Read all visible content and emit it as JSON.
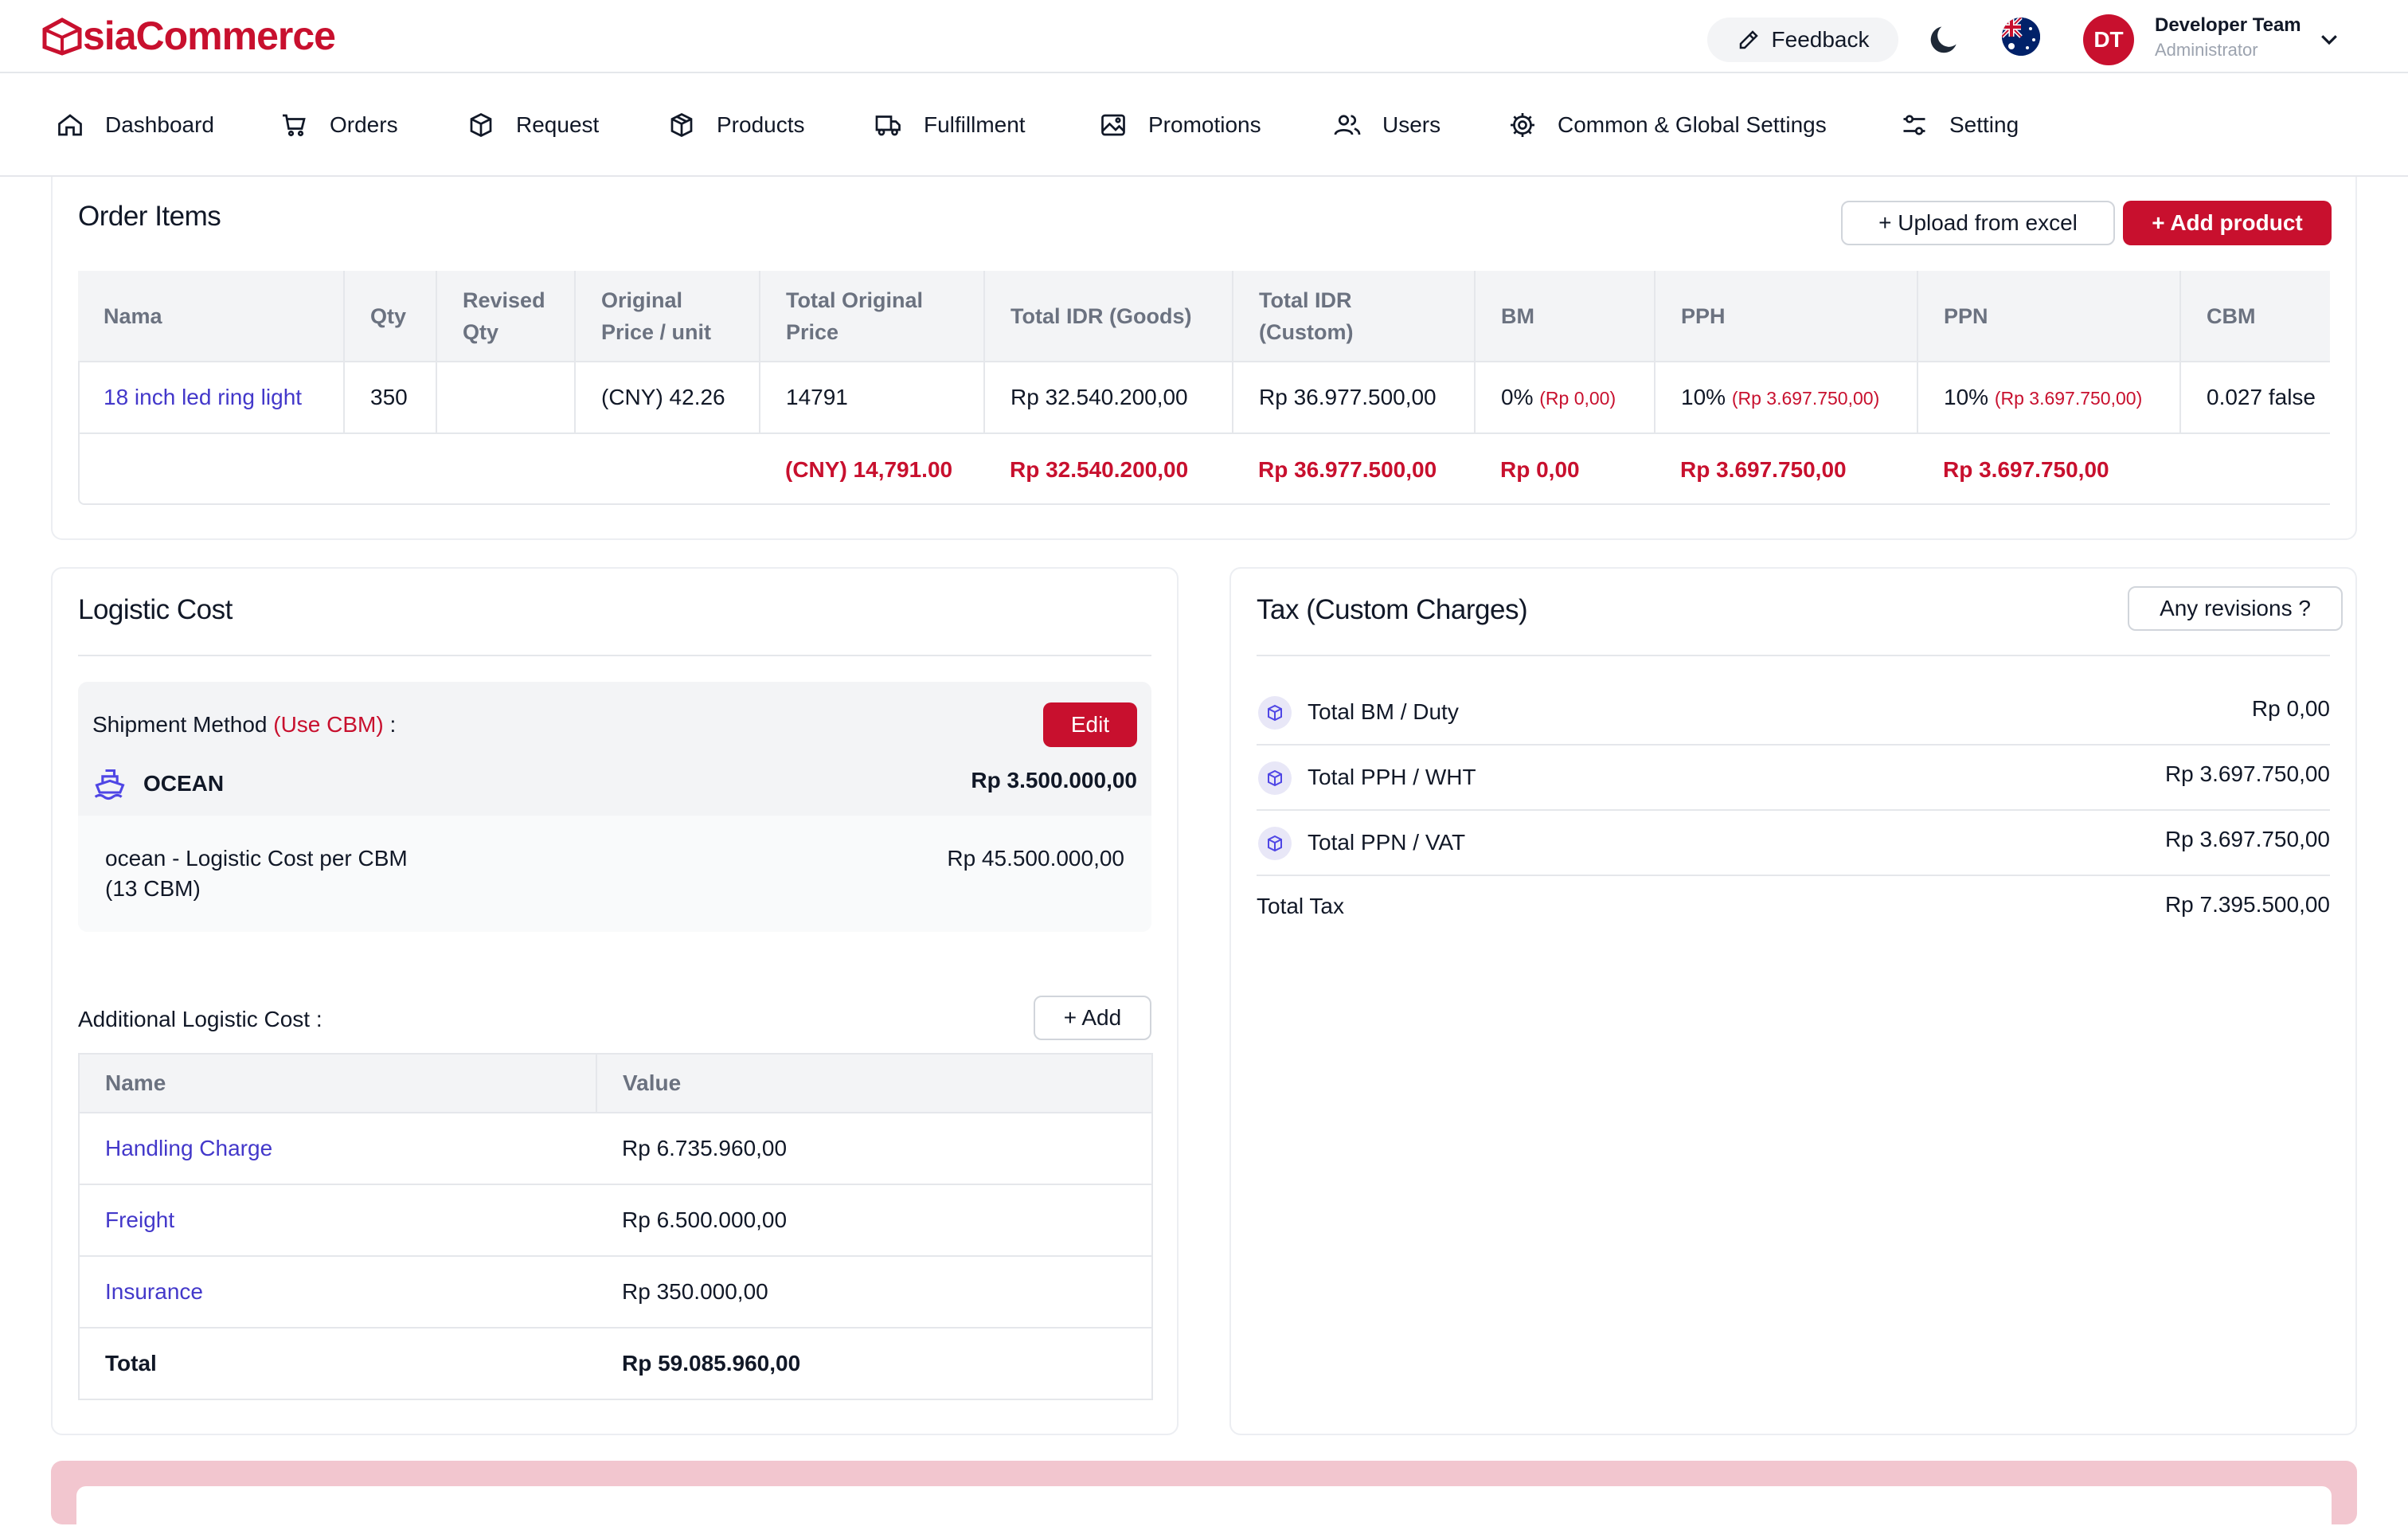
{
  "header": {
    "logo_text": "siaCommerce",
    "feedback_label": "Feedback",
    "user_initials": "DT",
    "user_name": "Developer Team",
    "user_role": "Administrator"
  },
  "nav": [
    {
      "label": "Dashboard",
      "icon": "home-icon"
    },
    {
      "label": "Orders",
      "icon": "cart-icon"
    },
    {
      "label": "Request",
      "icon": "box-icon"
    },
    {
      "label": "Products",
      "icon": "package-icon"
    },
    {
      "label": "Fulfillment",
      "icon": "truck-icon"
    },
    {
      "label": "Promotions",
      "icon": "image-icon"
    },
    {
      "label": "Users",
      "icon": "users-icon"
    },
    {
      "label": "Common & Global Settings",
      "icon": "gear-icon"
    },
    {
      "label": "Setting",
      "icon": "sliders-icon"
    }
  ],
  "order_items": {
    "title": "Order Items",
    "upload_label": "+ Upload from excel",
    "add_product_label": "+ Add product",
    "columns": [
      "Nama",
      "Qty",
      "Revised Qty",
      "Original Price / unit",
      "Total Original Price",
      "Total IDR (Goods)",
      "Total IDR (Custom)",
      "BM",
      "PPH",
      "PPN",
      "CBM"
    ],
    "rows": [
      {
        "name": "18 inch led ring light",
        "qty": "350",
        "revised_qty": "",
        "original_price": "(CNY) 42.26",
        "total_original": "14791",
        "total_idr_goods": "Rp 32.540.200,00",
        "total_idr_custom": "Rp 36.977.500,00",
        "bm": "0%",
        "bm_amount": "(Rp 0,00)",
        "pph": "10%",
        "pph_amount": "(Rp 3.697.750,00)",
        "ppn": "10%",
        "ppn_amount": "(Rp 3.697.750,00)",
        "cbm": "0.027 false"
      }
    ],
    "totals": {
      "total_original": "(CNY) 14,791.00",
      "total_idr_goods": "Rp 32.540.200,00",
      "total_idr_custom": "Rp 36.977.500,00",
      "bm": "Rp 0,00",
      "pph": "Rp 3.697.750,00",
      "ppn": "Rp 3.697.750,00"
    }
  },
  "logistic": {
    "title": "Logistic Cost",
    "shipment_label": "Shipment Method",
    "shipment_note": "(Use CBM)",
    "shipment_colon": ":",
    "edit_label": "Edit",
    "method": "OCEAN",
    "method_cost": "Rp 3.500.000,00",
    "detail_line1": "ocean - Logistic Cost per CBM",
    "detail_line2": "(13 CBM)",
    "detail_value": "Rp 45.500.000,00",
    "additional_label": "Additional Logistic Cost :",
    "add_label": "+ Add",
    "columns": [
      "Name",
      "Value"
    ],
    "rows": [
      {
        "name": "Handling Charge",
        "value": "Rp 6.735.960,00"
      },
      {
        "name": "Freight",
        "value": "Rp 6.500.000,00"
      },
      {
        "name": "Insurance",
        "value": "Rp 350.000,00"
      }
    ],
    "total_label": "Total",
    "total_value": "Rp 59.085.960,00"
  },
  "tax": {
    "title": "Tax (Custom Charges)",
    "revisions_label": "Any revisions ?",
    "rows": [
      {
        "label": "Total BM / Duty",
        "value": "Rp 0,00"
      },
      {
        "label": "Total PPH / WHT",
        "value": "Rp 3.697.750,00"
      },
      {
        "label": "Total PPN / VAT",
        "value": "Rp 3.697.750,00"
      }
    ],
    "total_label": "Total Tax",
    "total_value": "Rp 7.395.500,00"
  },
  "colors": {
    "brand": "#c8102e",
    "link": "#4338ca"
  }
}
